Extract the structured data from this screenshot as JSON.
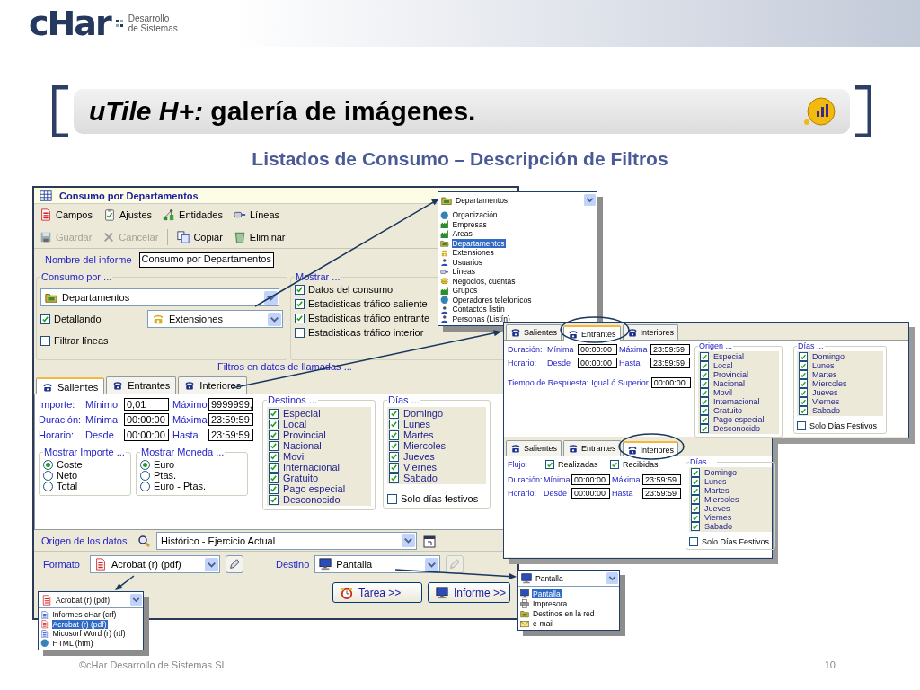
{
  "header": {
    "logo": "cHar",
    "tagline": [
      "Desarrollo",
      "de Sistemas"
    ]
  },
  "slide": {
    "title": "*uTile H+:* galería de imágenes.",
    "subtitle": "Listados de Consumo – Descripción de Filtros"
  },
  "main_window": {
    "title": "Consumo por Departamentos",
    "toolbar1": [
      {
        "label": "Campos"
      },
      {
        "label": "Ajustes"
      },
      {
        "label": "Entidades"
      },
      {
        "label": "Líneas"
      }
    ],
    "toolbar2": [
      {
        "label": "Guardar",
        "disabled": true
      },
      {
        "label": "Cancelar",
        "disabled": true
      },
      {
        "label": "Copiar",
        "disabled": false
      },
      {
        "label": "Eliminar",
        "disabled": false
      }
    ],
    "report_name": {
      "label": "Nombre del informe",
      "value": "Consumo por Departamentos"
    },
    "consumo_por": {
      "legend": "Consumo por ...",
      "entity": "Departamentos",
      "detail": {
        "label": "Detallando",
        "checked": true
      },
      "detail_entity": "Extensiones",
      "filter_lines": {
        "label": "Filtrar líneas",
        "checked": false
      }
    },
    "mostrar": {
      "legend": "Mostrar ...",
      "items": [
        {
          "label": "Datos del consumo",
          "checked": true
        },
        {
          "label": "Estadisticas tráfico saliente",
          "checked": true
        },
        {
          "label": "Estadisticas tráfico entrante",
          "checked": true
        },
        {
          "label": "Estadisticas tráfico interior",
          "checked": false
        }
      ]
    },
    "filters_caption": "Filtros en datos de llamadas ...",
    "tabs": [
      {
        "label": "Salientes",
        "selected": true
      },
      {
        "label": "Entrantes",
        "selected": false
      },
      {
        "label": "Interiores",
        "selected": false
      }
    ],
    "ranges": [
      {
        "label": "Importe:",
        "min_label": "Mínimo",
        "min": "0,01",
        "max_label": "Máximo",
        "max": "9999999,"
      },
      {
        "label": "Duración:",
        "min_label": "Mínima",
        "min": "00:00:00",
        "max_label": "Máxima",
        "max": "23:59:59"
      },
      {
        "label": "Horario:",
        "min_label": "Desde",
        "min": "00:00:00",
        "max_label": "Hasta",
        "max": "23:59:59"
      }
    ],
    "mostrar_importe": {
      "legend": "Mostrar Importe ...",
      "options": [
        {
          "label": "Coste",
          "selected": true
        },
        {
          "label": "Neto",
          "selected": false
        },
        {
          "label": "Total",
          "selected": false
        }
      ]
    },
    "mostrar_moneda": {
      "legend": "Mostrar Moneda ...",
      "options": [
        {
          "label": "Euro",
          "selected": true
        },
        {
          "label": "Ptas.",
          "selected": false
        },
        {
          "label": "Euro - Ptas.",
          "selected": false
        }
      ]
    },
    "destinos": {
      "legend": "Destinos ...",
      "items": [
        {
          "label": "Especial",
          "checked": true
        },
        {
          "label": "Local",
          "checked": true
        },
        {
          "label": "Provincial",
          "checked": true
        },
        {
          "label": "Nacional",
          "checked": true
        },
        {
          "label": "Movil",
          "checked": true
        },
        {
          "label": "Internacional",
          "checked": true
        },
        {
          "label": "Gratuito",
          "checked": true
        },
        {
          "label": "Pago especial",
          "checked": true
        },
        {
          "label": "Desconocido",
          "checked": true
        }
      ]
    },
    "dias": {
      "legend": "Días ...",
      "items": [
        {
          "label": "Domingo",
          "checked": true
        },
        {
          "label": "Lunes",
          "checked": true
        },
        {
          "label": "Martes",
          "checked": true
        },
        {
          "label": "Miercoles",
          "checked": true
        },
        {
          "label": "Jueves",
          "checked": true
        },
        {
          "label": "Viernes",
          "checked": true
        },
        {
          "label": "Sabado",
          "checked": true
        }
      ],
      "festivos": {
        "label": "Solo días festivos",
        "checked": false
      }
    },
    "origin": {
      "label": "Origen de los datos",
      "value": "Histórico - Ejercicio Actual"
    },
    "format": {
      "label": "Formato",
      "value": "Acrobat (r) (pdf)"
    },
    "destination": {
      "label": "Destino",
      "value": "Pantalla"
    },
    "buttons": [
      "Tarea >>",
      "Informe >>"
    ]
  },
  "entity_dropdown": {
    "value": "Departamentos",
    "options": [
      {
        "label": "Organización",
        "selected": false
      },
      {
        "label": "Empresas",
        "selected": false
      },
      {
        "label": "Areas",
        "selected": false
      },
      {
        "label": "Departamentos",
        "selected": true
      },
      {
        "label": "Extensiones",
        "selected": false
      },
      {
        "label": "Usuarios",
        "selected": false
      },
      {
        "label": "Líneas",
        "selected": false
      },
      {
        "label": "Negocios, cuentas",
        "selected": false
      },
      {
        "label": "Grupos",
        "selected": false
      },
      {
        "label": "Operadores telefonicos",
        "selected": false
      },
      {
        "label": "Contactos listín",
        "selected": false
      },
      {
        "label": "Personas (Listín)",
        "selected": false
      }
    ]
  },
  "entrantes_panel": {
    "kind": "incoming",
    "tabs": [
      {
        "label": "Salientes",
        "selected": false
      },
      {
        "label": "Entrantes",
        "selected": true
      },
      {
        "label": "Interiores",
        "selected": false
      }
    ],
    "ranges": [
      {
        "label": "Duración:",
        "min_label": "Mínima",
        "min": "00:00:00",
        "max_label": "Máxima",
        "max": "23:59:59"
      },
      {
        "label": "Horario:",
        "min_label": "Desde",
        "min": "00:00:00",
        "max_label": "Hasta",
        "max": "23:59:59"
      }
    ],
    "response": {
      "label": "Tiempo de Respuesta:",
      "qualifier": "Igual ó Superior",
      "value": "00:00:00"
    },
    "origen": {
      "legend": "Origen ...",
      "items": [
        {
          "label": "Especial",
          "checked": true
        },
        {
          "label": "Local",
          "checked": true
        },
        {
          "label": "Provincial",
          "checked": true
        },
        {
          "label": "Nacional",
          "checked": true
        },
        {
          "label": "Movil",
          "checked": true
        },
        {
          "label": "Internacional",
          "checked": true
        },
        {
          "label": "Gratuito",
          "checked": true
        },
        {
          "label": "Pago especial",
          "checked": true
        },
        {
          "label": "Desconocido",
          "checked": true
        }
      ]
    },
    "dias": {
      "legend": "Días ...",
      "items": [
        {
          "label": "Domingo",
          "checked": true
        },
        {
          "label": "Lunes",
          "checked": true
        },
        {
          "label": "Martes",
          "checked": true
        },
        {
          "label": "Miercoles",
          "checked": true
        },
        {
          "label": "Jueves",
          "checked": true
        },
        {
          "label": "Viernes",
          "checked": true
        },
        {
          "label": "Sabado",
          "checked": true
        }
      ],
      "festivos": {
        "label": "Solo Días Festivos",
        "checked": false
      }
    }
  },
  "interiores_panel": {
    "kind": "internal",
    "tabs": [
      {
        "label": "Salientes",
        "selected": false
      },
      {
        "label": "Entrantes",
        "selected": false
      },
      {
        "label": "Interiores",
        "selected": true
      }
    ],
    "flow": {
      "label": "Flujo:",
      "items": [
        {
          "label": "Realizadas",
          "checked": true
        },
        {
          "label": "Recibidas",
          "checked": true
        }
      ]
    },
    "ranges": [
      {
        "label": "Duración:",
        "min_label": "Mínima",
        "min": "00:00:00",
        "max_label": "Máxima",
        "max": "23:59:59"
      },
      {
        "label": "Horario:",
        "min_label": "Desde",
        "min": "00:00:00",
        "max_label": "Hasta",
        "max": "23:59:59"
      }
    ],
    "dias": {
      "legend": "Días ...",
      "items": [
        {
          "label": "Domingo",
          "checked": true
        },
        {
          "label": "Lunes",
          "checked": true
        },
        {
          "label": "Martes",
          "checked": true
        },
        {
          "label": "Miercoles",
          "checked": true
        },
        {
          "label": "Jueves",
          "checked": true
        },
        {
          "label": "Viernes",
          "checked": true
        },
        {
          "label": "Sabado",
          "checked": true
        }
      ],
      "festivos": {
        "label": "Solo Días Festivos",
        "checked": false
      }
    }
  },
  "format_dropdown": {
    "value": "Acrobat (r) (pdf)",
    "options": [
      {
        "label": "Informes cHar (crf)",
        "selected": false
      },
      {
        "label": "Acrobat (r) (pdf)",
        "selected": true
      },
      {
        "label": "Micosorf Word (r) (rtf)",
        "selected": false
      },
      {
        "label": "HTML (htm)",
        "selected": false
      }
    ]
  },
  "destination_dropdown": {
    "value": "Pantalla",
    "options": [
      {
        "label": "Pantalla",
        "selected": true
      },
      {
        "label": "Impresora",
        "selected": false
      },
      {
        "label": "Destinos en la red",
        "selected": false
      },
      {
        "label": "e-mail",
        "selected": false
      }
    ]
  },
  "footer": {
    "copyright": "©cHar Desarrollo de Sistemas SL",
    "page": "10"
  }
}
